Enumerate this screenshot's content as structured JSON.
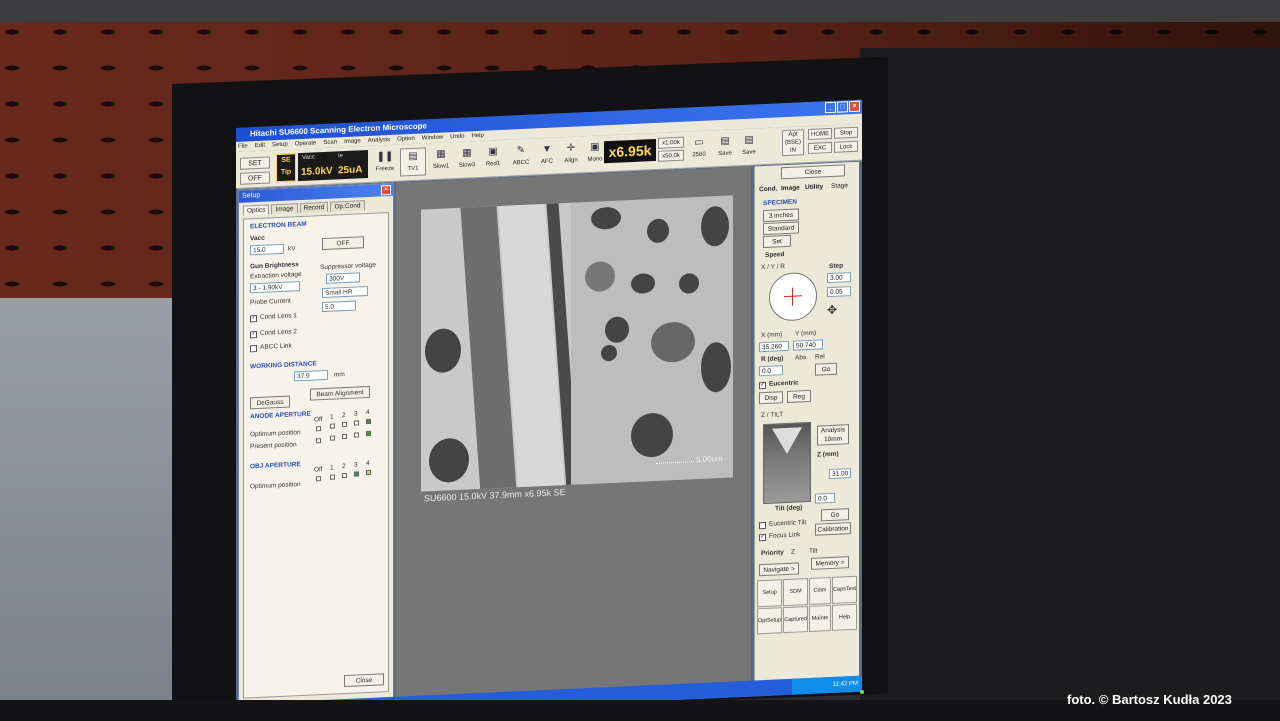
{
  "window": {
    "title": "Hitachi SU6600 Scanning Electron Microscope",
    "menu": [
      "File",
      "Edit",
      "Setup",
      "Operate",
      "Scan",
      "Image",
      "Analysis",
      "Option",
      "Window",
      "Undo",
      "Help"
    ]
  },
  "toolbar": {
    "set": "SET",
    "off": "OFF",
    "se": "SE",
    "tip": "Tip",
    "vacc_label": "Vacc",
    "ie_label": "Ie",
    "vacc_value": "15.0kV",
    "ie_value": "25uA",
    "freeze": "Freeze",
    "tv1": "TV1",
    "slow1": "Slow1",
    "slow3": "Slow3",
    "red1": "Red1",
    "abcc": "ABCC",
    "afc": "AFC",
    "align": "Align",
    "mono": "Mono",
    "magnification": "x6.95k",
    "mag_x1": "x1.00k",
    "mag_x50": "x50.0k",
    "res": "2560",
    "save": "Save",
    "save2": "Save",
    "apt": "Apt (BSE) IN",
    "home": "HOME",
    "exc": "EXC",
    "stop": "Stop",
    "lock": "Lock"
  },
  "setup": {
    "title": "Setup",
    "close_x": "×",
    "tabs": [
      "Optics",
      "Image",
      "Record",
      "Op.Cond"
    ],
    "electron_beam": "ELECTRON BEAM",
    "vacc": "Vacc",
    "vacc_value": "15.0",
    "vacc_unit": "kV",
    "off_button": "OFF",
    "gun_brightness": "Gun Brightness",
    "extraction_voltage": "Extraction voltage",
    "extraction_value": "3 - 1.90kV",
    "suppressor_voltage": "Suppressor voltage",
    "suppressor_value": "300V",
    "probe_current": "Probe Current",
    "probe_mode": "Small HR",
    "probe_value": "5.0",
    "cond_lens_1": "Cond Lens 1",
    "cond_lens_2": "Cond Lens 2",
    "abcc_link": "ABCC Link",
    "working_distance": "WORKING DISTANCE",
    "wd_value": "37.9",
    "wd_unit": "mm",
    "degauss": "DeGauss",
    "beam_alignment": "Beam Alignment",
    "anode_aperture": "ANODE APERTURE",
    "aperture_cols": [
      "Off",
      "1",
      "2",
      "3",
      "4"
    ],
    "optimum_position": "Optimum position",
    "present_position": "Present position",
    "obj_aperture": "OBJ APERTURE",
    "obj_optimum": "Optimum position",
    "close_button": "Close"
  },
  "image": {
    "info_label": "SU6600 15.0kV 37.9mm x6.95k SE",
    "scale_label": "5.00um"
  },
  "right_panel": {
    "close": "Close",
    "tabs": [
      "Cond.",
      "Image",
      "Utility",
      "Stage"
    ],
    "specimen": "SPECIMEN",
    "size": "3 inches",
    "holder": "Standard",
    "set": "Set",
    "speed": "Speed",
    "xyr": "X / Y / R",
    "step": "Step",
    "step_x": "3.00",
    "step_y": "0.05",
    "x_label": "X (mm)",
    "y_label": "Y (mm)",
    "x_value": "35.260",
    "y_value": "50.740",
    "r_label": "R (deg)",
    "abs": "Abs",
    "rel": "Rel",
    "r_value": "0.0",
    "go": "Go",
    "eucentric": "Eucentric",
    "disp": "Disp",
    "reg": "Reg",
    "z_tilt": "Z / TILT",
    "analysis": "Analysis 10mm",
    "z_label": "Z (mm)",
    "z_value": "31.00",
    "tilt_label": "Tilt (deg)",
    "tilt_value": "0.0",
    "go2": "Go",
    "eucentric_tilt": "Eucentric Tilt",
    "focus_link": "Focus Link",
    "calibration": "Calibration",
    "priority": "Priority",
    "prio_z": "Z",
    "prio_tilt": "Tilt",
    "navigate": "Navigate >",
    "memory": "Memory >",
    "tools": [
      "Setup",
      "SDM",
      "Cdim",
      "CapsText",
      "OptSetup",
      "Captured",
      "Mainte",
      "Help"
    ]
  },
  "taskbar": {
    "clock": "11:42 PM"
  },
  "credit": "foto. © Bartosz Kudła 2023"
}
